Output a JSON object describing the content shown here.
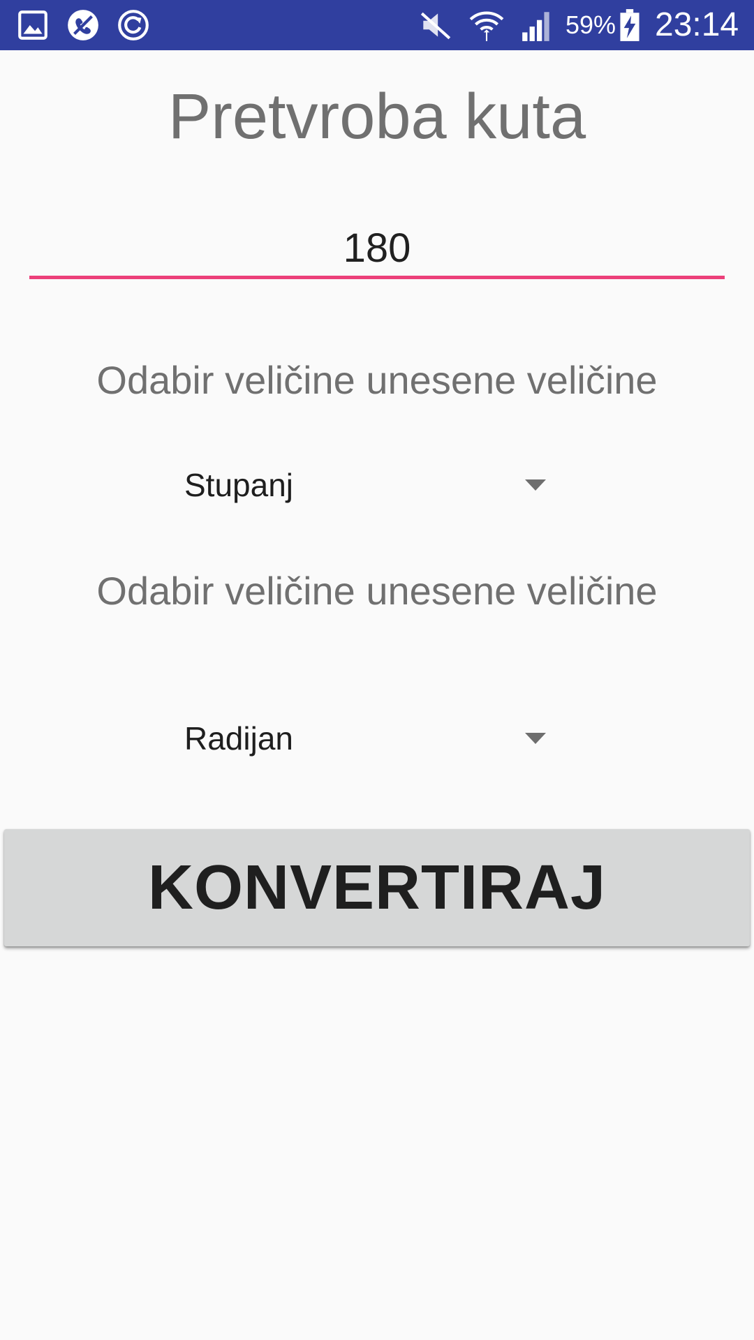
{
  "status_bar": {
    "background": "#303f9f",
    "icons_left": [
      "gallery-icon",
      "call-blocked-icon",
      "sync-icon"
    ],
    "icons_right": [
      "mute-icon",
      "wifi-icon",
      "signal-icon",
      "battery-charging-icon"
    ],
    "battery_percent": "59%",
    "time": "23:14"
  },
  "main": {
    "title": "Pretvroba kuta",
    "angle_input": {
      "value": "180",
      "underline_color": "#ec407a"
    },
    "from_label": "Odabir veličine unesene veličine",
    "from_unit": {
      "selected": "Stupanj"
    },
    "to_label": "Odabir veličine unesene veličine",
    "to_unit": {
      "selected": "Radijan"
    },
    "convert_button": {
      "label": "KONVERTIRAJ"
    }
  }
}
